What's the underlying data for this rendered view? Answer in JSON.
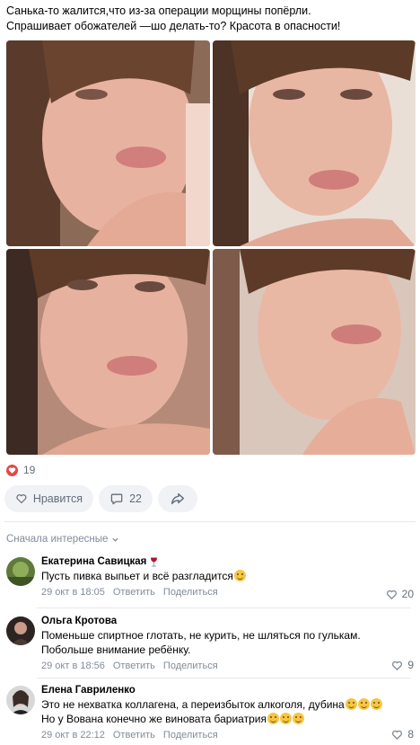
{
  "post": {
    "text_line1": "Санька-то жалится,что из-за операции морщины попёрли.",
    "text_line2": "Спрашивает обожателей —шо делать-то? Красота в опасности!"
  },
  "reactions": {
    "count": "19"
  },
  "actions": {
    "like_label": "Нравится",
    "comments_count": "22"
  },
  "comments_sort": {
    "label": "Сначала интересные"
  },
  "comments": [
    {
      "author": "Екатерина Савицкая",
      "text": "Пусть пивка выпьет и всё разгладится",
      "date": "29 окт в 18:05",
      "reply": "Ответить",
      "share": "Поделиться",
      "likes": "20"
    },
    {
      "author": "Ольга Кротова",
      "text": "Поменьше спиртное глотать, не курить, не шляться по гулькам. Побольше внимание ребёнку.",
      "date": "29 окт в 18:56",
      "reply": "Ответить",
      "share": "Поделиться",
      "likes": "9"
    },
    {
      "author": "Елена Гавриленко",
      "text_line1": "Это не нехватка коллагена, а переизбыток алкоголя, дубина",
      "text_line2": "Но у Вована конечно же виновата бариатрия",
      "date": "29 окт в 22:12",
      "reply": "Ответить",
      "share": "Поделиться",
      "likes": "8"
    }
  ],
  "colors": {
    "accent": "#e64646",
    "secondary_text": "#818c99",
    "pill_bg": "#f0f2f5"
  }
}
